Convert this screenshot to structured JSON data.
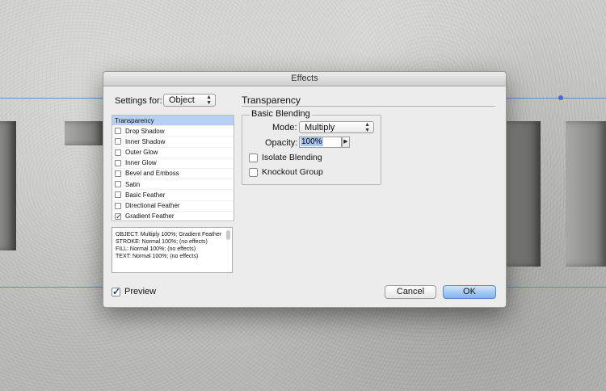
{
  "dialog": {
    "title": "Effects",
    "settings_for_label": "Settings for:",
    "settings_for_value": "Object",
    "effects": [
      {
        "label": "Transparency",
        "checked": false,
        "selected": true,
        "has_checkbox": false
      },
      {
        "label": "Drop Shadow",
        "checked": false,
        "selected": false,
        "has_checkbox": true
      },
      {
        "label": "Inner Shadow",
        "checked": false,
        "selected": false,
        "has_checkbox": true
      },
      {
        "label": "Outer Glow",
        "checked": false,
        "selected": false,
        "has_checkbox": true
      },
      {
        "label": "Inner Glow",
        "checked": false,
        "selected": false,
        "has_checkbox": true
      },
      {
        "label": "Bevel and Emboss",
        "checked": false,
        "selected": false,
        "has_checkbox": true
      },
      {
        "label": "Satin",
        "checked": false,
        "selected": false,
        "has_checkbox": true
      },
      {
        "label": "Basic Feather",
        "checked": false,
        "selected": false,
        "has_checkbox": true
      },
      {
        "label": "Directional Feather",
        "checked": false,
        "selected": false,
        "has_checkbox": true
      },
      {
        "label": "Gradient Feather",
        "checked": true,
        "selected": false,
        "has_checkbox": true
      }
    ],
    "summary_lines": [
      "OBJECT: Multiply 100%; Gradient Feather",
      "STROKE: Normal 100%; (no effects)",
      "FILL: Normal 100%; (no effects)",
      "TEXT: Normal 100%; (no effects)"
    ],
    "preview_label": "Preview",
    "preview_checked": true,
    "section_title": "Transparency",
    "basic_blending": {
      "group_title": "Basic Blending",
      "mode_label": "Mode:",
      "mode_value": "Multiply",
      "opacity_label": "Opacity:",
      "opacity_value": "100%",
      "isolate_label": "Isolate Blending",
      "knockout_label": "Knockout Group"
    },
    "cancel_label": "Cancel",
    "ok_label": "OK"
  }
}
